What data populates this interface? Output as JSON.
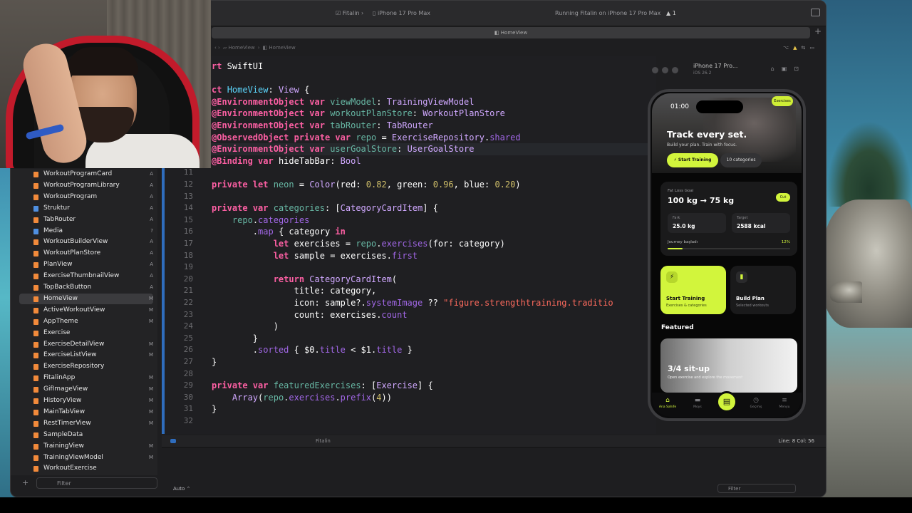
{
  "toolbar": {
    "scheme": "Fitalin",
    "device": "iPhone 17 Pro Max",
    "status": "Running Fitalin on iPhone 17 Pro Max",
    "warnings": "1"
  },
  "tab": {
    "title": "HomeView"
  },
  "jumpbar": {
    "folder": "HomeView",
    "file": "HomeView"
  },
  "navigator": {
    "items": [
      {
        "name": "WorkoutProgramCard",
        "status": "A",
        "color": "#f28a3b"
      },
      {
        "name": "WorkoutProgramLibrary",
        "status": "A",
        "color": "#f28a3b"
      },
      {
        "name": "WorkoutProgram",
        "status": "A",
        "color": "#f28a3b"
      },
      {
        "name": "Struktur",
        "status": "A",
        "color": "#4f8fe0"
      },
      {
        "name": "TabRouter",
        "status": "A",
        "color": "#f28a3b"
      },
      {
        "name": "Media",
        "status": "?",
        "color": "#4f8fe0"
      },
      {
        "name": "WorkoutBuilderView",
        "status": "A",
        "color": "#f28a3b"
      },
      {
        "name": "WorkoutPlanStore",
        "status": "A",
        "color": "#f28a3b"
      },
      {
        "name": "PlanView",
        "status": "A",
        "color": "#f28a3b"
      },
      {
        "name": "ExerciseThumbnailView",
        "status": "A",
        "color": "#f28a3b"
      },
      {
        "name": "TopBackButton",
        "status": "A",
        "color": "#f28a3b"
      },
      {
        "name": "HomeView",
        "status": "M",
        "color": "#f28a3b",
        "selected": true
      },
      {
        "name": "ActiveWorkoutView",
        "status": "M",
        "color": "#f28a3b"
      },
      {
        "name": "AppTheme",
        "status": "M",
        "color": "#f28a3b"
      },
      {
        "name": "Exercise",
        "status": "",
        "color": "#f28a3b"
      },
      {
        "name": "ExerciseDetailView",
        "status": "M",
        "color": "#f28a3b"
      },
      {
        "name": "ExerciseListView",
        "status": "M",
        "color": "#f28a3b"
      },
      {
        "name": "ExerciseRepository",
        "status": "",
        "color": "#f28a3b"
      },
      {
        "name": "FitalinApp",
        "status": "M",
        "color": "#f28a3b"
      },
      {
        "name": "GifImageView",
        "status": "M",
        "color": "#f28a3b"
      },
      {
        "name": "HistoryView",
        "status": "M",
        "color": "#f28a3b"
      },
      {
        "name": "MainTabView",
        "status": "M",
        "color": "#f28a3b"
      },
      {
        "name": "RestTimerView",
        "status": "M",
        "color": "#f28a3b"
      },
      {
        "name": "SampleData",
        "status": "",
        "color": "#f28a3b"
      },
      {
        "name": "TrainingView",
        "status": "M",
        "color": "#f28a3b"
      },
      {
        "name": "TrainingViewModel",
        "status": "M",
        "color": "#f28a3b"
      },
      {
        "name": "WorkoutExercise",
        "status": "",
        "color": "#f28a3b"
      }
    ],
    "filter_placeholder": "Filter"
  },
  "editor": {
    "lines": [
      {
        "n": "",
        "html": "<span class=\"kw\">rt</span> SwiftUI"
      },
      {
        "n": "",
        "html": ""
      },
      {
        "n": "",
        "html": "<span class=\"kw\">ct</span> <span class=\"tn\">HomeView</span>: <span class=\"ty\">View</span> {"
      },
      {
        "n": "",
        "html": "<span class=\"kw\">@EnvironmentObject</span> <span class=\"kw\">var</span> <span class=\"pr\">viewModel</span>: <span class=\"ty\">TrainingViewModel</span>"
      },
      {
        "n": "",
        "html": "<span class=\"kw\">@EnvironmentObject</span> <span class=\"kw\">var</span> <span class=\"pr\">workoutPlanStore</span>: <span class=\"ty\">WorkoutPlanStore</span>"
      },
      {
        "n": "",
        "html": "<span class=\"kw\">@EnvironmentObject</span> <span class=\"kw\">var</span> <span class=\"pr\">tabRouter</span>: <span class=\"ty\">TabRouter</span>"
      },
      {
        "n": "",
        "html": "<span class=\"kw\">@ObservedObject</span> <span class=\"kw\">private var</span> <span class=\"pr\">repo</span> = <span class=\"ty\">ExerciseRepository</span>.<span class=\"fn\">shared</span>"
      },
      {
        "n": "",
        "html": "<span class=\"kw\">@EnvironmentObject</span> <span class=\"kw\">var</span> <span class=\"pr\">userGoalStore</span>: <span class=\"ty\">UserGoalStore</span>",
        "current": true
      },
      {
        "n": "10",
        "html": "<span class=\"kw\">@Binding</span> <span class=\"kw\">var</span> hideTabBar: <span class=\"ty\">Bool</span>"
      },
      {
        "n": "11",
        "html": ""
      },
      {
        "n": "12",
        "html": "<span class=\"kw\">private let</span> <span class=\"pr\">neon</span> = <span class=\"ty\">Color</span>(red: <span class=\"nm\">0.82</span>, green: <span class=\"nm\">0.96</span>, blue: <span class=\"nm\">0.20</span>)"
      },
      {
        "n": "13",
        "html": ""
      },
      {
        "n": "14",
        "html": "<span class=\"kw\">private var</span> <span class=\"pr\">categories</span>: [<span class=\"ty\">CategoryCardItem</span>] {"
      },
      {
        "n": "15",
        "html": "    <span class=\"pr\">repo</span>.<span class=\"fn\">categories</span>"
      },
      {
        "n": "16",
        "html": "        .<span class=\"fn\">map</span> { category <span class=\"kw\">in</span>"
      },
      {
        "n": "17",
        "html": "            <span class=\"kw\">let</span> exercises = <span class=\"pr\">repo</span>.<span class=\"fn\">exercises</span>(for: category)"
      },
      {
        "n": "18",
        "html": "            <span class=\"kw\">let</span> sample = exercises.<span class=\"fn\">first</span>"
      },
      {
        "n": "19",
        "html": ""
      },
      {
        "n": "20",
        "html": "            <span class=\"kw\">return</span> <span class=\"ty\">CategoryCardItem</span>("
      },
      {
        "n": "21",
        "html": "                title: category,"
      },
      {
        "n": "22",
        "html": "                icon: sample?.<span class=\"fn\">systemImage</span> ?? <span class=\"st\">\"figure.strengthtraining.traditio</span>"
      },
      {
        "n": "23",
        "html": "                count: exercises.<span class=\"fn\">count</span>"
      },
      {
        "n": "24",
        "html": "            )"
      },
      {
        "n": "25",
        "html": "        }"
      },
      {
        "n": "26",
        "html": "        .<span class=\"fn\">sorted</span> { $0.<span class=\"fn\">title</span> &lt; $1.<span class=\"fn\">title</span> }"
      },
      {
        "n": "27",
        "html": "}"
      },
      {
        "n": "28",
        "html": ""
      },
      {
        "n": "29",
        "html": "<span class=\"kw\">private var</span> <span class=\"pr\">featuredExercises</span>: [<span class=\"ty\">Exercise</span>] {"
      },
      {
        "n": "30",
        "html": "    <span class=\"ty\">Array</span>(<span class=\"pr\">repo</span>.<span class=\"fn\">exercises</span>.<span class=\"fn\">prefix</span>(<span class=\"nm\">4</span>))"
      },
      {
        "n": "31",
        "html": "}"
      },
      {
        "n": "32",
        "html": ""
      }
    ]
  },
  "status": {
    "scheme": "Fitalin",
    "position": "Line: 8  Col: 56"
  },
  "debug": {
    "mode": "Auto",
    "filter_placeholder": "Filter"
  },
  "simulator": {
    "title": "iPhone 17 Pro...",
    "subtitle": "iOS 26.2"
  },
  "app": {
    "time": "01:00",
    "hero_badge": "Exercises",
    "hero_title": "Track every set.",
    "hero_subtitle": "Build your plan. Train with focus.",
    "start_training": "Start Training",
    "categories": "10 categories",
    "goal": {
      "label": "Fat Loss Goal",
      "value": "100 kg → 75 kg",
      "badge": "Cut",
      "stat1_label": "Fark",
      "stat1_value": "25.0 kg",
      "stat2_label": "Target",
      "stat2_value": "2588 kcal",
      "journey_label": "Journey başladı",
      "journey_pct": "12%",
      "journey_fraction": 0.12
    },
    "actions": [
      {
        "title": "Start Training",
        "subtitle": "Exercises & categories",
        "icon": "⚡"
      },
      {
        "title": "Build Plan",
        "subtitle": "Selected workouts",
        "icon": "▮"
      }
    ],
    "featured_title": "Featured",
    "featured": {
      "name": "3/4 sit-up",
      "desc": "Open exercise and explore the movement"
    },
    "tabs": [
      {
        "label": "Ana Sahife",
        "icon": "⌂",
        "active": true
      },
      {
        "label": "Moys",
        "icon": "▬"
      },
      {
        "label": "Geçmiş",
        "icon": "◷"
      },
      {
        "label": "Menyu",
        "icon": "≡"
      }
    ],
    "accent": "#d2f53c"
  }
}
